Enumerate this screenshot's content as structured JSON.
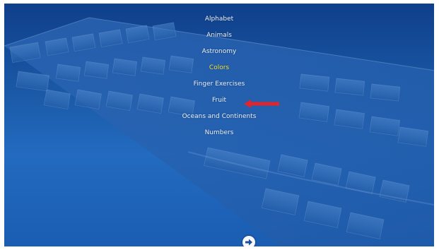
{
  "menu": {
    "items": [
      {
        "label": "Alphabet",
        "selected": false
      },
      {
        "label": "Animals",
        "selected": false
      },
      {
        "label": "Astronomy",
        "selected": false
      },
      {
        "label": "Colors",
        "selected": true
      },
      {
        "label": "Finger Exercises",
        "selected": false
      },
      {
        "label": "Fruit",
        "selected": false
      },
      {
        "label": "Oceans and Continents",
        "selected": false
      },
      {
        "label": "Numbers",
        "selected": false
      }
    ]
  },
  "annotation": {
    "icon": "red-left-arrow-icon",
    "color": "#e2242c"
  },
  "navigation": {
    "next_icon": "arrow-right-icon"
  },
  "theme": {
    "background": "#1b5aa8",
    "text": "#e9f0fb",
    "selected_text": "#f2e33c"
  }
}
